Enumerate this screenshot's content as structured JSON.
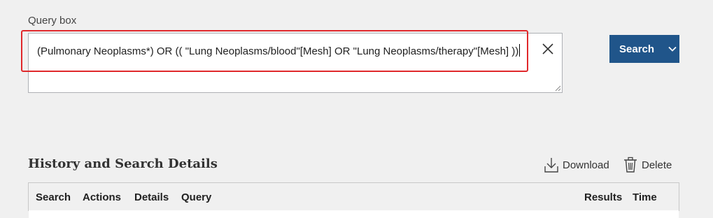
{
  "query": {
    "label": "Query box",
    "value": "(Pulmonary Neoplasms*) OR (( \"Lung Neoplasms/blood\"[Mesh] OR \"Lung Neoplasms/therapy\"[Mesh] ))",
    "highlight_color": "#e0282b"
  },
  "search_button": {
    "label": "Search",
    "color": "#20558a"
  },
  "history": {
    "title": "History and Search Details",
    "download_label": "Download",
    "delete_label": "Delete",
    "columns": [
      "Search",
      "Actions",
      "Details",
      "Query",
      "Results",
      "Time"
    ]
  },
  "icons": [
    "close-icon",
    "chevron-down-icon",
    "download-icon",
    "trash-icon",
    "resize-grip-icon"
  ]
}
